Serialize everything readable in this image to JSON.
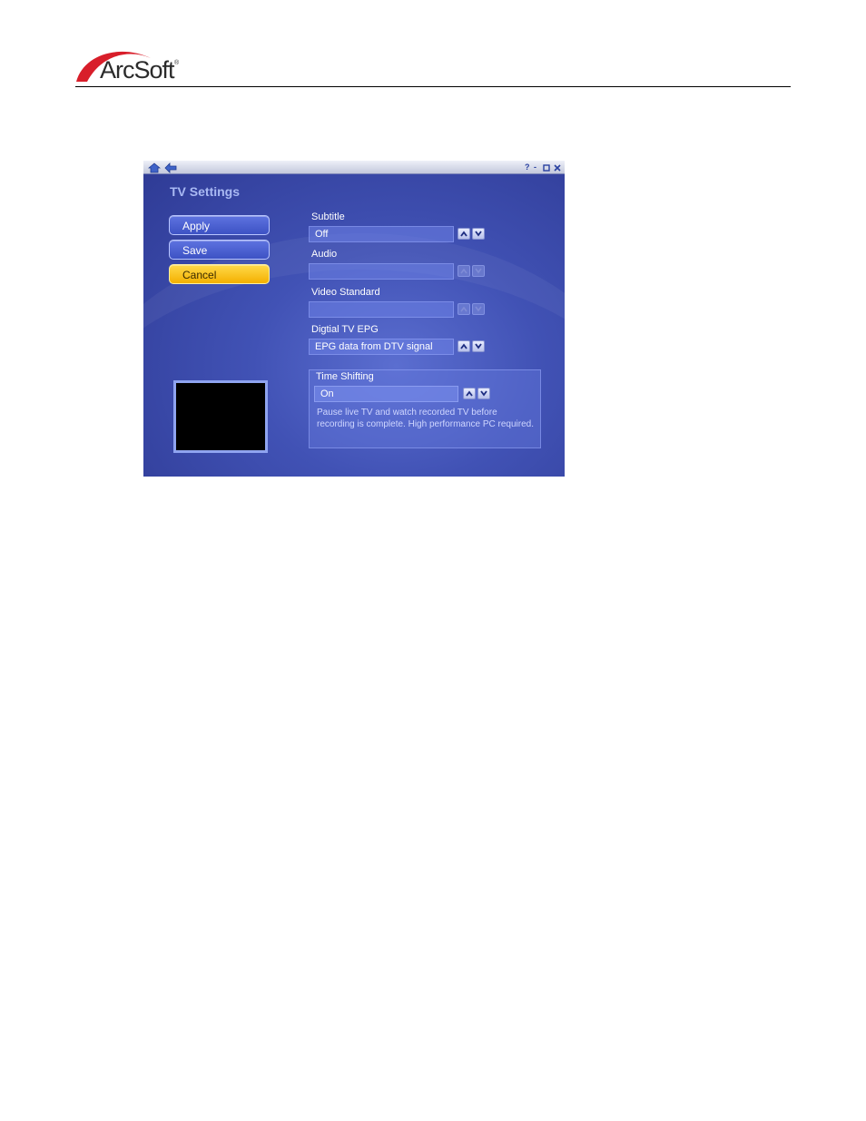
{
  "brand": {
    "logo_text": "ArcSoft",
    "registered": "®"
  },
  "app": {
    "title": "TV Settings",
    "topbar": {
      "home_icon": "home-icon",
      "back_icon": "back-arrow-icon",
      "help": "?",
      "minimize": "-",
      "restore": "restore-icon",
      "close": "close-icon"
    },
    "buttons": {
      "apply": "Apply",
      "save": "Save",
      "cancel": "Cancel"
    },
    "fields": {
      "subtitle": {
        "label": "Subtitle",
        "value": "Off"
      },
      "audio": {
        "label": "Audio",
        "value": ""
      },
      "video_standard": {
        "label": "Video Standard",
        "value": ""
      },
      "epg": {
        "label": "Digtial TV EPG",
        "value": "EPG data from DTV signal"
      }
    },
    "time_shifting": {
      "label": "Time Shifting",
      "value": "On",
      "description": "Pause live TV and watch recorded TV before recording is complete. High performance PC required."
    }
  },
  "colors": {
    "accent": "#4152b5",
    "cancel": "#f4b000",
    "title": "#a9b9f3"
  }
}
